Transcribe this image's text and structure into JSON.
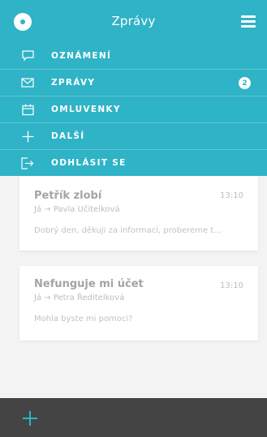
{
  "header": {
    "title": "Zprávy",
    "logo_icon": "logo-icon",
    "menu_icon": "hamburger-icon"
  },
  "menu": {
    "items": [
      {
        "label": "OZNÁMENÍ",
        "icon": "speech-bubble-icon"
      },
      {
        "label": "ZPRÁVY",
        "icon": "envelope-icon",
        "badge": "2"
      },
      {
        "label": "OMLUVENKY",
        "icon": "calendar-icon"
      },
      {
        "label": "DALŠÍ",
        "icon": "plus-icon"
      },
      {
        "label": "ODHLÁSIT SE",
        "icon": "logout-icon"
      }
    ]
  },
  "messages": [
    {
      "title": "Petřík zlobí",
      "time": "13:10",
      "recipient": "Já → Pavla Učitelková",
      "preview": "Dobrý den, děkuji za informaci, probereme t..."
    },
    {
      "title": "Nefunguje mi účet",
      "time": "13:10",
      "recipient": "Já → Petra Ředitelková",
      "preview": "Mohla byste mi pomoci?"
    }
  ],
  "footer": {
    "add_icon": "plus-icon"
  },
  "colors": {
    "accent": "#2fb3c6",
    "bottom_bar": "#444444",
    "background": "#f3f3f3"
  }
}
